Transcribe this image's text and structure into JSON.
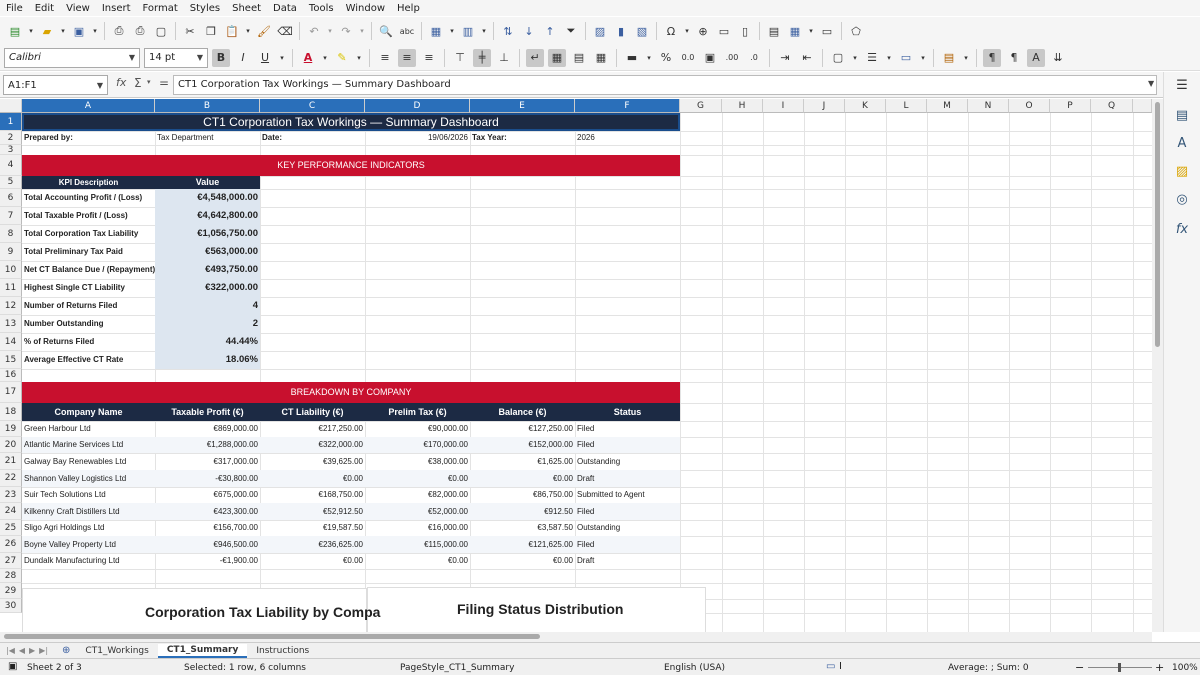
{
  "menu": [
    "File",
    "Edit",
    "View",
    "Insert",
    "Format",
    "Styles",
    "Sheet",
    "Data",
    "Tools",
    "Window",
    "Help"
  ],
  "toolbar": {
    "font_name": "Calibri",
    "font_size": "14 pt",
    "bold": "B",
    "italic": "I",
    "underline": "U",
    "percent": "%",
    "decimal": "0.0",
    "add_decimal": ".00",
    "del_decimal": ".0"
  },
  "formula_bar": {
    "name_box": "A1:F1",
    "content": "CT1 Corporation Tax Workings — Summary Dashboard"
  },
  "columns": [
    "A",
    "B",
    "C",
    "D",
    "E",
    "F",
    "G",
    "H",
    "I",
    "J",
    "K",
    "L",
    "M",
    "N",
    "O",
    "P",
    "Q"
  ],
  "rows": [
    "1",
    "2",
    "3",
    "4",
    "5",
    "6",
    "7",
    "8",
    "9",
    "10",
    "11",
    "12",
    "13",
    "14",
    "15",
    "16",
    "17",
    "18",
    "19",
    "20",
    "21",
    "22",
    "23",
    "24",
    "25",
    "26",
    "27",
    "28",
    "29",
    "30"
  ],
  "sheet": {
    "title": "CT1 Corporation Tax Workings — Summary Dashboard",
    "prepared_by_label": "Prepared by:",
    "prepared_by": "Tax Department",
    "date_label": "Date:",
    "date": "19/06/2026",
    "tax_year_label": "Tax Year:",
    "tax_year": "2026",
    "kpi_section": "KEY PERFORMANCE INDICATORS",
    "kpi_head_desc": "KPI Description",
    "kpi_head_value": "Value",
    "kpis": [
      {
        "label": "Total Accounting Profit / (Loss)",
        "value": "€4,548,000.00"
      },
      {
        "label": "Total Taxable Profit / (Loss)",
        "value": "€4,642,800.00"
      },
      {
        "label": "Total Corporation Tax Liability",
        "value": "€1,056,750.00"
      },
      {
        "label": "Total Preliminary Tax Paid",
        "value": "€563,000.00"
      },
      {
        "label": "Net CT Balance Due / (Repayment)",
        "value": "€493,750.00"
      },
      {
        "label": "Highest Single CT Liability",
        "value": "€322,000.00"
      },
      {
        "label": "Number of Returns Filed",
        "value": "4"
      },
      {
        "label": "Number Outstanding",
        "value": "2"
      },
      {
        "label": "% of Returns Filed",
        "value": "44.44%"
      },
      {
        "label": "Average Effective CT Rate",
        "value": "18.06%"
      }
    ],
    "breakdown_section": "BREAKDOWN BY COMPANY",
    "breakdown_headers": [
      "Company Name",
      "Taxable Profit (€)",
      "CT Liability (€)",
      "Prelim Tax (€)",
      "Balance (€)",
      "Status"
    ],
    "companies": [
      [
        "Green Harbour Ltd",
        "€869,000.00",
        "€217,250.00",
        "€90,000.00",
        "€127,250.00",
        "Filed"
      ],
      [
        "Atlantic Marine Services Ltd",
        "€1,288,000.00",
        "€322,000.00",
        "€170,000.00",
        "€152,000.00",
        "Filed"
      ],
      [
        "Galway Bay Renewables Ltd",
        "€317,000.00",
        "€39,625.00",
        "€38,000.00",
        "€1,625.00",
        "Outstanding"
      ],
      [
        "Shannon Valley Logistics Ltd",
        "-€30,800.00",
        "€0.00",
        "€0.00",
        "€0.00",
        "Draft"
      ],
      [
        "Suir Tech Solutions Ltd",
        "€675,000.00",
        "€168,750.00",
        "€82,000.00",
        "€86,750.00",
        "Submitted to Agent"
      ],
      [
        "Kilkenny Craft Distillers Ltd",
        "€423,300.00",
        "€52,912.50",
        "€52,000.00",
        "€912.50",
        "Filed"
      ],
      [
        "Sligo Agri Holdings Ltd",
        "€156,700.00",
        "€19,587.50",
        "€16,000.00",
        "€3,587.50",
        "Outstanding"
      ],
      [
        "Boyne Valley Property Ltd",
        "€946,500.00",
        "€236,625.00",
        "€115,000.00",
        "€121,625.00",
        "Filed"
      ],
      [
        "Dundalk Manufacturing Ltd",
        "-€1,900.00",
        "€0.00",
        "€0.00",
        "€0.00",
        "Draft"
      ]
    ],
    "chart1_title": "Corporation Tax Liability by Compa",
    "chart2_title": "Filing Status Distribution"
  },
  "tabs": [
    "CT1_Workings",
    "CT1_Summary",
    "Instructions"
  ],
  "active_tab": "CT1_Summary",
  "status": {
    "sheet": "Sheet 2 of 3",
    "selection": "Selected: 1 row, 6 columns",
    "page_style": "PageStyle_CT1_Summary",
    "language": "English (USA)",
    "sum": "Average: ; Sum: 0",
    "zoom": "100%"
  },
  "colors": {
    "navy": "#1c2a44",
    "red": "#c8102e",
    "kpi_value_bg": "#dde6f0",
    "stripe": "#f3f6fa",
    "selection": "#2a6fba"
  }
}
